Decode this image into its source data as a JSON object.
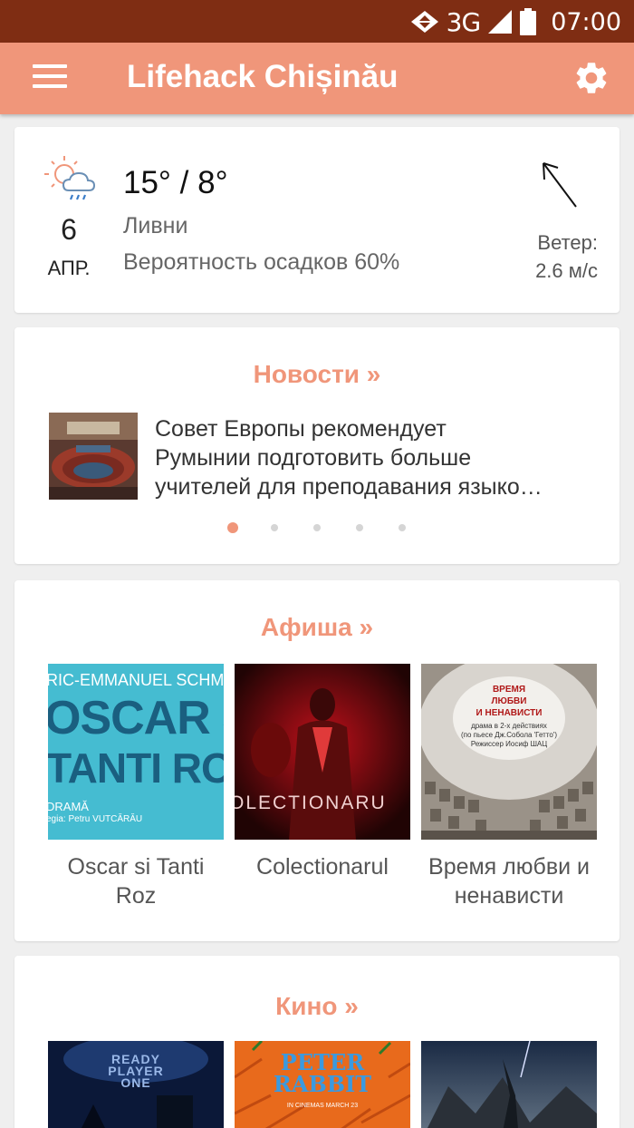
{
  "status": {
    "network": "3G",
    "time": "07:00"
  },
  "appbar": {
    "title": "Lifehack Chișinău"
  },
  "weather": {
    "day": "6",
    "month": "АПР.",
    "temp": "15° / 8°",
    "condition": "Ливни",
    "precip": "Вероятность осадков 60%",
    "wind_label": "Ветер:",
    "wind_value": "2.6 м/с"
  },
  "news": {
    "title": "Новости »",
    "headline_lines": [
      "Совет Европы рекомендует",
      "Румынии подготовить больше",
      "учителей для преподавания языко…"
    ],
    "pages": 5,
    "active_page": 1
  },
  "afisha": {
    "title": "Афиша »",
    "items": [
      {
        "label_lines": [
          "Oscar si Tanti",
          "Roz"
        ],
        "poster": {
          "top": "RIC-EMMANUEL SCHMITT",
          "line1": "OSCAR Ș",
          "line2": "TANTI ROZ",
          "sub1": "DRAMĂ",
          "sub2": "egia: Petru VUTCĂRĂU"
        }
      },
      {
        "label_lines": [
          "Colectionarul"
        ],
        "poster": {
          "text": "OLECTIONARU"
        }
      },
      {
        "label_lines": [
          "Время любви и",
          "ненависти"
        ],
        "poster": {
          "t1": "ВРЕМЯ",
          "t2": "ЛЮБВИ",
          "t3": "И НЕНАВИСТИ",
          "t4": "драма в 2-х действиях",
          "t5": "(по пьесе Дж.Собола 'Гетто')",
          "t6": "Режиссер  Иосиф ШАЦ"
        }
      }
    ]
  },
  "kino": {
    "title": "Кино »",
    "items": [
      {
        "poster_text_1": "READY",
        "poster_text_2": "PLAYER",
        "poster_text_3": "ONE"
      },
      {
        "poster_text_1": "PETER",
        "poster_text_2": "RABBIT",
        "poster_text_3": "IN CINEMAS MARCH 23"
      },
      {
        "poster_text_1": ""
      }
    ]
  }
}
